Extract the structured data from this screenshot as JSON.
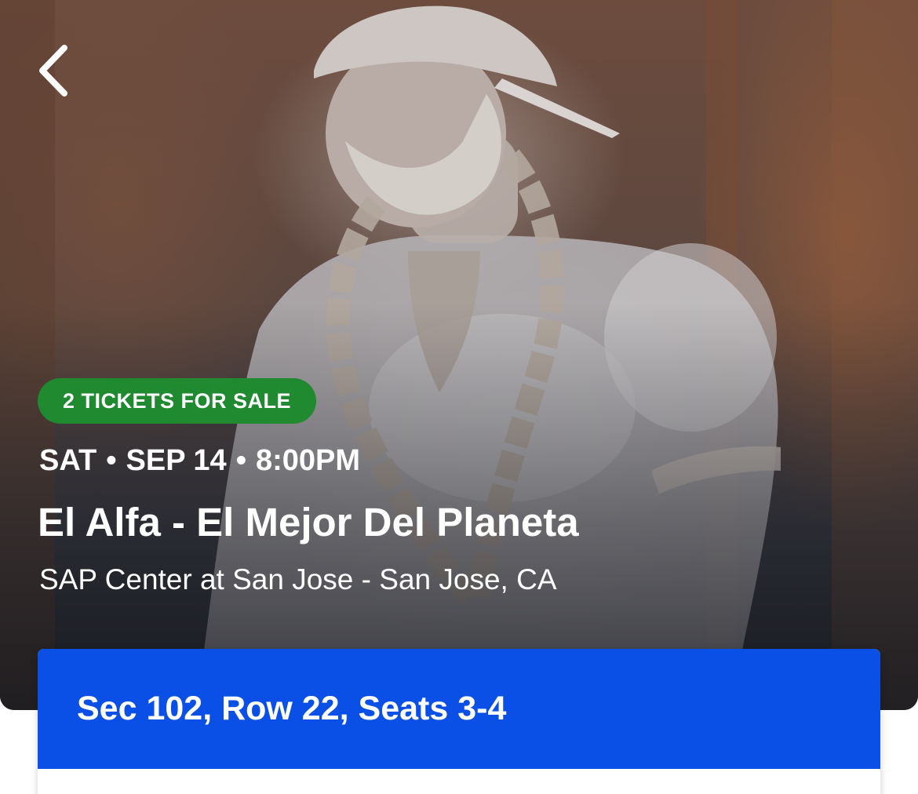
{
  "navigation": {
    "back_icon": "chevron-left-icon"
  },
  "event": {
    "badge": "2 TICKETS FOR SALE",
    "day": "SAT",
    "date": "SEP 14",
    "time": "8:00PM",
    "separator": "•",
    "title": "El Alfa - El Mejor Del Planeta",
    "venue": "SAP Center at San Jose - San Jose, CA"
  },
  "ticket": {
    "seat_info": "Sec 102, Row 22, Seats 3-4"
  },
  "colors": {
    "badge_green": "#1f8a2f",
    "ticket_blue": "#0a4fe6",
    "text_white": "#ffffff"
  }
}
